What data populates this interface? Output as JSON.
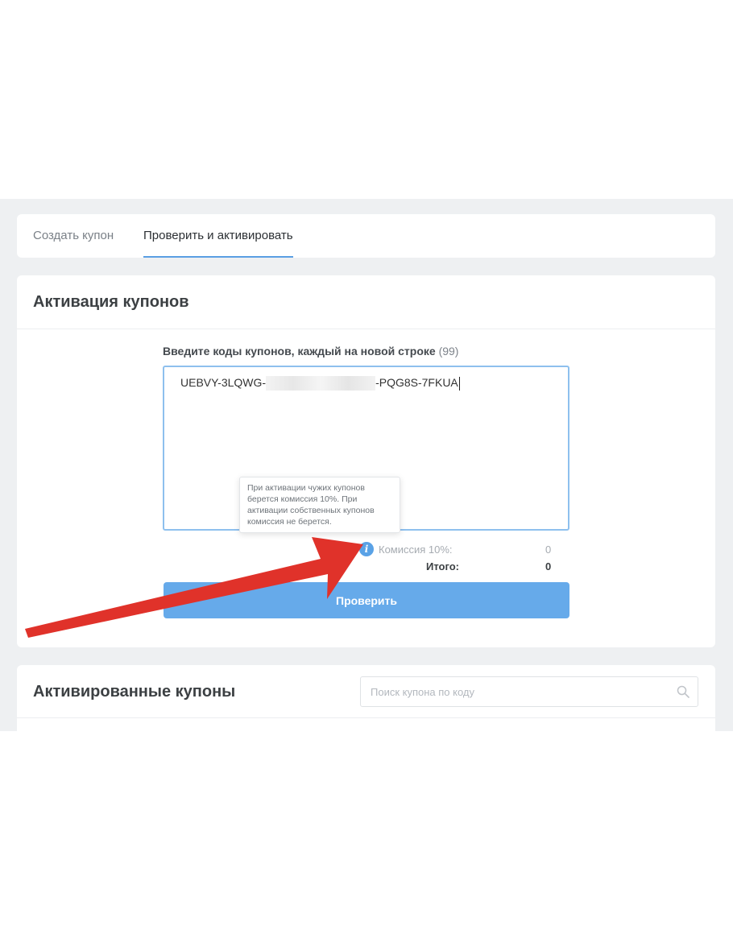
{
  "tabs": [
    {
      "label": "Создать купон",
      "active": false
    },
    {
      "label": "Проверить и активировать",
      "active": true
    }
  ],
  "activation": {
    "title": "Активация купонов",
    "field_label": "Введите коды купонов, каждый на новой строке",
    "field_count": "(99)",
    "code_start": "UEBVY-3LQWG-",
    "code_end": "-PQG8S-7FKUA",
    "tooltip": "При активации чужих купонов берется комиссия 10%. При активации собственных купонов комиссия не берется.",
    "commission_label": "Комиссия 10%:",
    "commission_value": "0",
    "total_label": "Итого:",
    "total_value": "0",
    "check_button": "Проверить"
  },
  "activated": {
    "title": "Активированные купоны",
    "search_placeholder": "Поиск купона по коду"
  },
  "colors": {
    "accent": "#5a9fe3",
    "button": "#66aaea",
    "arrow": "#e0322a",
    "background": "#eef0f2"
  },
  "icons": [
    "info-icon",
    "search-icon",
    "red-arrow-annotation"
  ]
}
